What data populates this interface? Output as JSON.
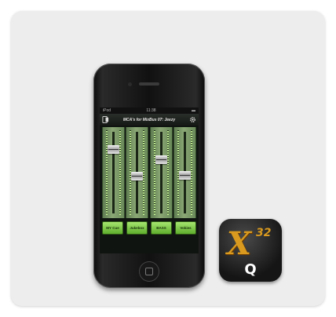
{
  "phone": {
    "status_left": "iPod",
    "status_time": "11:38",
    "title": "MCA's for MixBus 07: Jeezy"
  },
  "channels": [
    {
      "label": "MY Cue",
      "fader_level": 0.82
    },
    {
      "label": "Jukebox",
      "fader_level": 0.45
    },
    {
      "label": "BASS",
      "fader_level": 0.68
    },
    {
      "label": "Vokies",
      "fader_level": 0.46
    }
  ],
  "app_icon": {
    "letter": "X",
    "number": "32",
    "sub": "Q",
    "accent": "#d99a1f"
  },
  "colors": {
    "strip": "#8aa774",
    "button": "#7ccb45"
  }
}
